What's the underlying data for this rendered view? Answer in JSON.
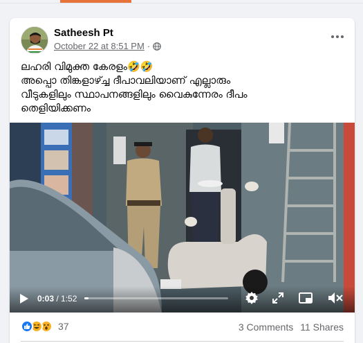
{
  "post": {
    "author": "Satheesh Pt",
    "timestamp": "October 22 at 8:51 PM",
    "separator": "·",
    "caption_lines": [
      "ലഹരി വിമുക്ത കേരളം🤣🤣",
      "അപ്പൊ തിങ്കളാഴ്ച്ച ദീപാവലിയാണ് എല്ലാരും",
      "വീടുകളിലും സ്ഥാപനങ്ങളിലും വൈകുന്നേരം ദീപം",
      "തെളിയിക്കണം"
    ]
  },
  "video": {
    "current_time": "0:03",
    "duration": "1:52",
    "time_display": "0:03 / 1:52",
    "progress": 0.03
  },
  "footer": {
    "reaction_count": "37",
    "comments": "3 Comments",
    "shares": "11 Shares"
  },
  "colors": {
    "tab_accent": "#e8733a",
    "like_blue": "#1877f2",
    "haha_yellow": "#f7b125",
    "text_secondary": "#65676b"
  },
  "icons": [
    "globe-icon",
    "more-options-icon",
    "play-icon",
    "settings-icon",
    "fullscreen-icon",
    "miniplayer-icon",
    "volume-muted-icon",
    "like-reaction-icon",
    "haha-reaction-icon",
    "wow-reaction-icon"
  ]
}
